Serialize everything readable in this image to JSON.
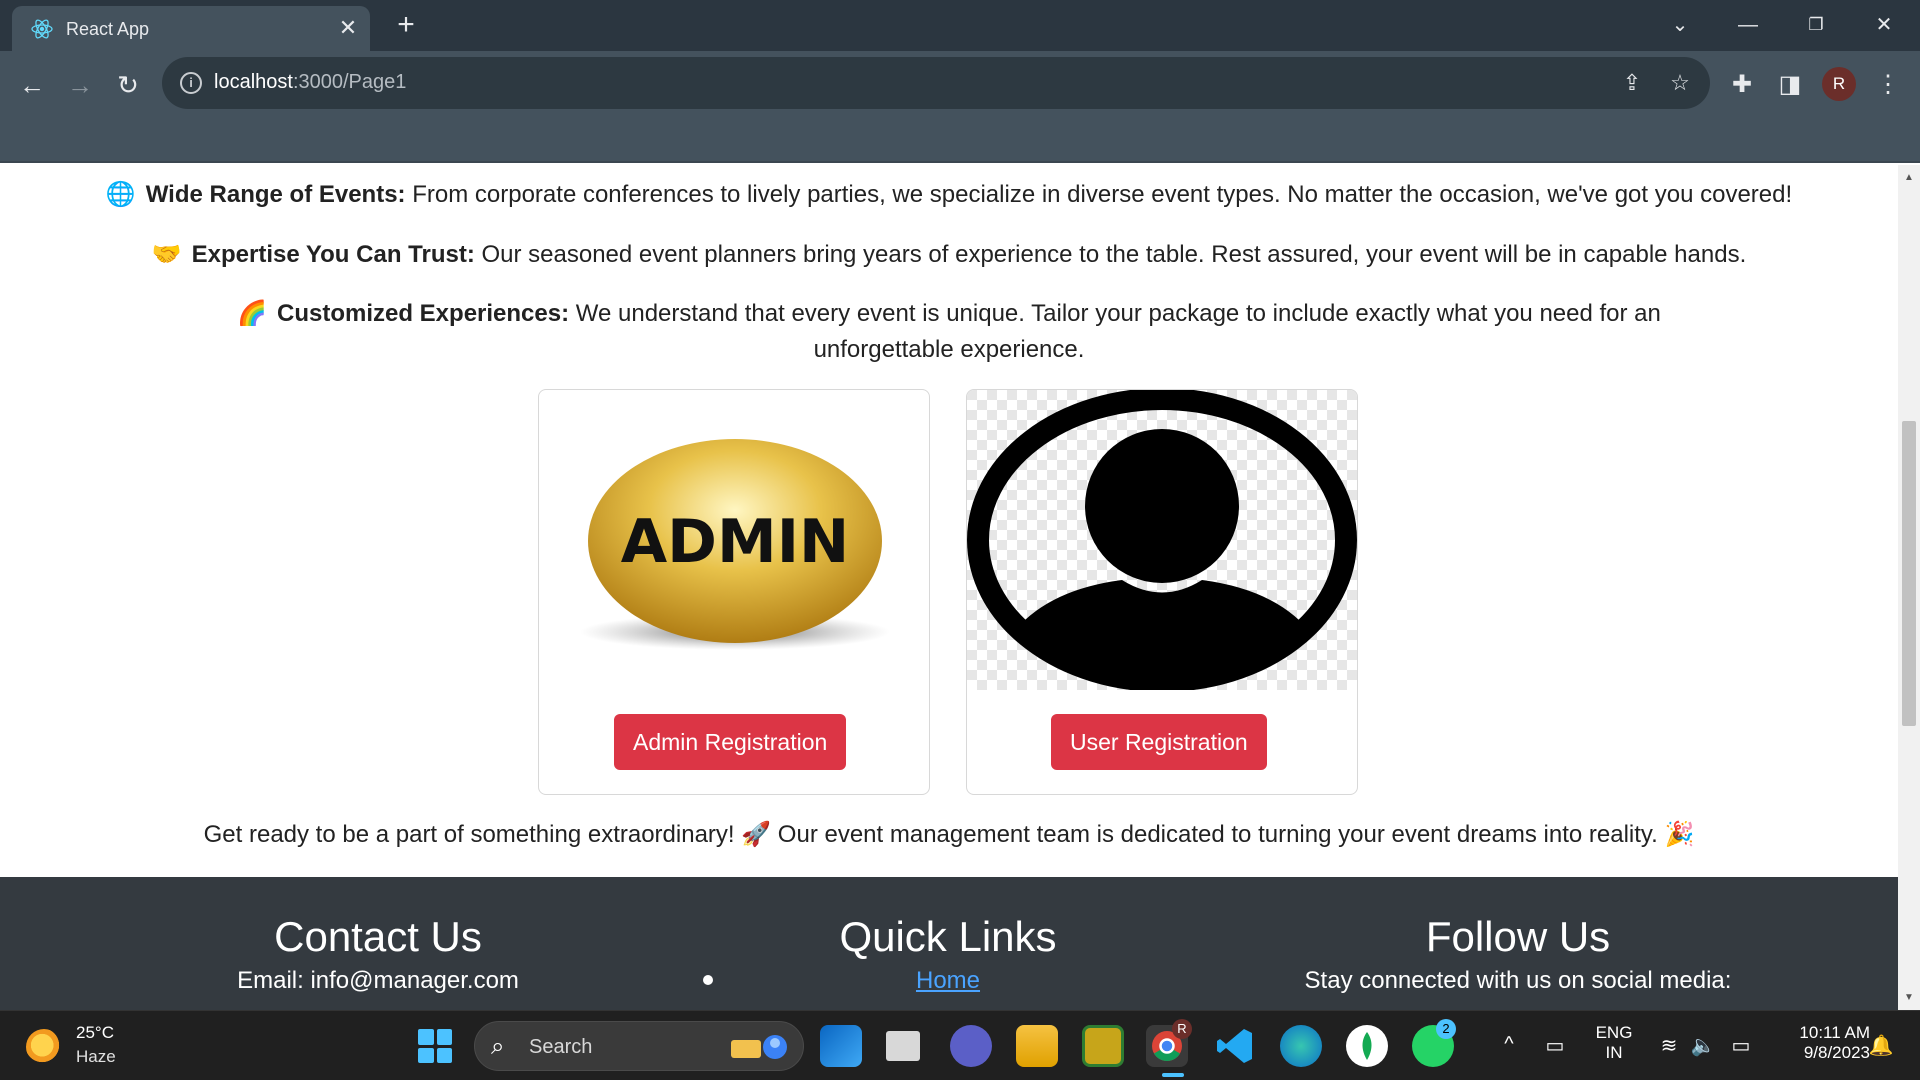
{
  "browser": {
    "tab_title": "React App",
    "new_tab_label": "+",
    "url_host": "localhost",
    "url_path": ":3000/Page1",
    "profile_initial": "R"
  },
  "features": [
    {
      "icon": "🌐",
      "title": "Wide Range of Events:",
      "text": "From corporate conferences to lively parties, we specialize in diverse event types. No matter the occasion, we've got you covered!"
    },
    {
      "icon": "🤝",
      "title": "Expertise You Can Trust:",
      "text": "Our seasoned event planners bring years of experience to the table. Rest assured, your event will be in capable hands."
    },
    {
      "icon": "🌈",
      "title": "Customized Experiences:",
      "text": "We understand that every event is unique. Tailor your package to include exactly what you need for an unforgettable experience."
    }
  ],
  "cards": {
    "admin": {
      "image_text": "ADMIN",
      "button_label": "Admin Registration"
    },
    "user": {
      "button_label": "User Registration"
    }
  },
  "tagline": "Get ready to be a part of something extraordinary! 🚀 Our event management team is dedicated to turning your event dreams into reality. 🎉",
  "footer": {
    "contact": {
      "heading": "Contact Us",
      "email": "Email: info@manager.com"
    },
    "quick_links": {
      "heading": "Quick Links",
      "items": [
        "Home"
      ]
    },
    "follow": {
      "heading": "Follow Us",
      "text": "Stay connected with us on social media:"
    }
  },
  "taskbar": {
    "weather_temp": "25°C",
    "weather_desc": "Haze",
    "search_placeholder": "Search",
    "whatsapp_badge": "2",
    "chrome_badge": "R",
    "language_top": "ENG",
    "language_bottom": "IN",
    "time": "10:11 AM",
    "date": "9/8/2023"
  },
  "colors": {
    "accent_button": "#dc3545",
    "footer_bg": "#343a40",
    "chrome_bg": "#44525d",
    "taskbar_bg": "#202020",
    "link": "#4aa3ff"
  }
}
